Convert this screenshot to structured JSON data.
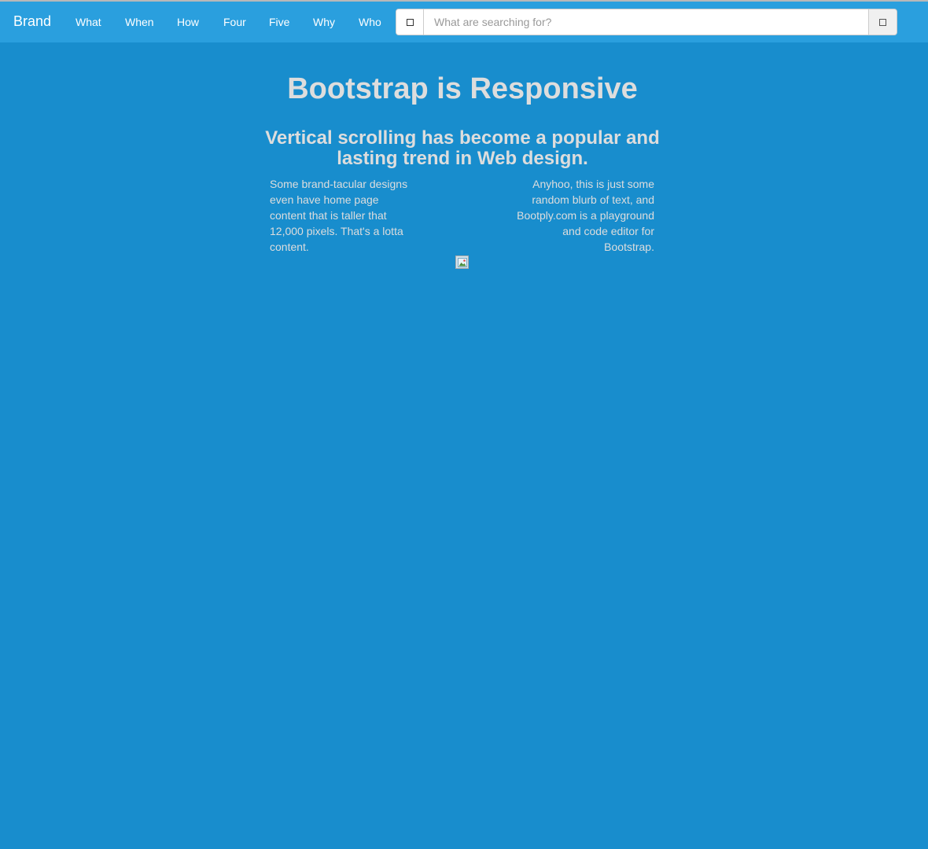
{
  "navbar": {
    "brand": "Brand",
    "links": [
      "What",
      "When",
      "How",
      "Four",
      "Five",
      "Why",
      "Who"
    ],
    "search": {
      "placeholder": "What are searching for?",
      "value": "",
      "left_icon": "square-icon",
      "button_icon": "square-icon"
    }
  },
  "main": {
    "title": "Bootstrap is Responsive",
    "subtitle": "Vertical scrolling has become a popular and lasting trend in Web design.",
    "left_blurb": "Some brand-tacular designs even have home page content that is taller that 12,000 pixels. That's a lotta content.",
    "right_blurb": "Anyhoo, this is just some random blurb of text, and Bootply.com is a playground and code editor for Bootstrap.",
    "image_icon": "broken-image-icon"
  },
  "colors": {
    "page_background": "#188dcd",
    "navbar_background": "#2a9fde",
    "text": "#dddddd",
    "nav_text": "#ffffff"
  }
}
